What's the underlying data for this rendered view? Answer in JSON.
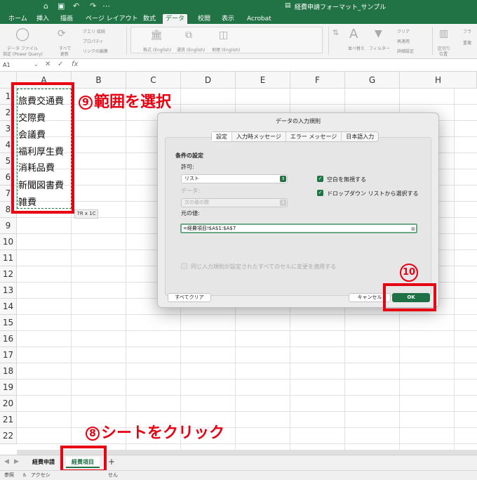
{
  "titlebar": {
    "title": "経費申請フォーマット_サンプル"
  },
  "tabs": [
    "ホーム",
    "挿入",
    "描画",
    "ページ レイアウト",
    "数式",
    "データ",
    "校閲",
    "表示",
    "Acrobat"
  ],
  "active_tab": "データ",
  "ribbon": {
    "get_data": "データ ファイル",
    "get_data_sub": "指定 (Power Query)",
    "refresh_all": "すべて",
    "refresh_all_sub": "更新",
    "queries": "クエリ 接続",
    "properties": "プロパティ",
    "edit_links": "リンクの編集",
    "stock": "株式 (English)",
    "currency": "通貨 (English)",
    "geography": "地理 (English)",
    "sort": "並べ替え",
    "filter": "フィルター",
    "clear": "クリア",
    "reapply": "再適用",
    "advanced": "詳細設定",
    "text_to_columns": "区切り",
    "text_to_columns_sub": "位置",
    "flash_fill": "フラ",
    "remove_dup": "重複"
  },
  "formula_bar": {
    "name_box": "A1",
    "fx": "fx"
  },
  "columns": [
    "A",
    "B",
    "C",
    "D",
    "E",
    "F",
    "G",
    "H"
  ],
  "rows": [
    "1",
    "2",
    "3",
    "4",
    "5",
    "6",
    "7",
    "8",
    "9",
    "10",
    "11",
    "12",
    "13",
    "14",
    "15",
    "16",
    "17",
    "18",
    "19",
    "20",
    "21",
    "22"
  ],
  "cells": [
    "旅費交通費",
    "交際費",
    "会議費",
    "福利厚生費",
    "消耗品費",
    "新聞図書費",
    "雑費"
  ],
  "selection_tooltip": "7R x 1C",
  "annotations": {
    "step9_num": "9",
    "step9_text": "範囲を選択",
    "step8_num": "8",
    "step8_text": "シートをクリック",
    "step10_num": "10"
  },
  "dialog": {
    "title": "データの入力規則",
    "tabs": [
      "設定",
      "入力時メッセージ",
      "エラー メッセージ",
      "日本語入力"
    ],
    "active_tab": "設定",
    "section": "条件の設定",
    "allow_label": "許可:",
    "allow_value": "リスト",
    "data_label": "データ:",
    "data_value": "次の値の間",
    "ignore_blank": "空白を無視する",
    "in_cell_dropdown": "ドロップダウン リストから選択する",
    "source_label": "元の値:",
    "source_value": "=経費項目!$A$1:$A$7",
    "apply_all": "同じ入力規則が設定されたすべてのセルに変更を適用する",
    "clear_all": "すべてクリア",
    "cancel": "キャンセル",
    "ok": "OK"
  },
  "sheets": [
    "経費申請",
    "経費項目"
  ],
  "active_sheet": "経費項目",
  "add_sheet": "+",
  "status": {
    "mode": "参照",
    "accessibility": "アクセシ",
    "accessibility_end": "せん"
  },
  "colors": {
    "excel_green": "#217346",
    "annotation_red": "#e60012"
  }
}
